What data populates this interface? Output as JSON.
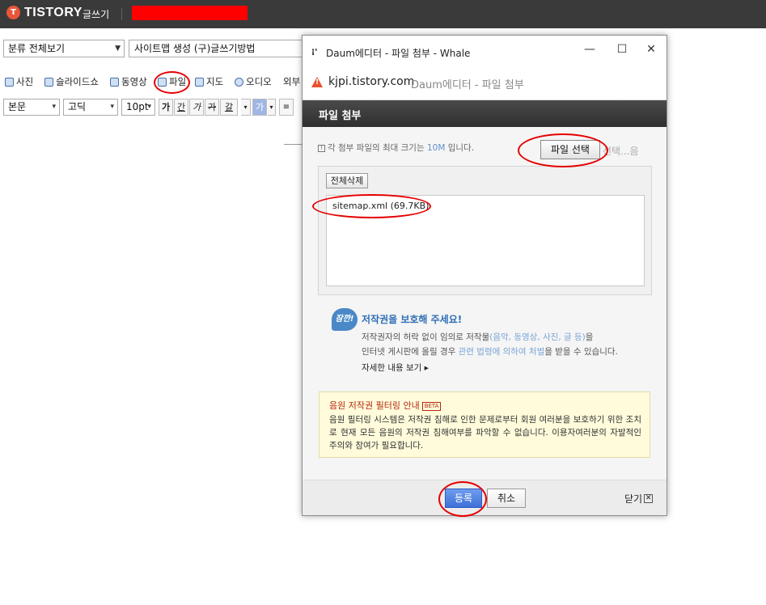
{
  "topbar": {
    "logo_glyph": "T",
    "logo_text": "TISTORY",
    "subtitle": "글쓰기",
    "redaction_color": "#ff0000"
  },
  "editor": {
    "category_select": "분류 전체보기",
    "title_value": "사이트맵 생성 (구)글쓰기방법",
    "toolbar": {
      "photo": "사진",
      "slideshow": "슬라이드쇼",
      "video": "동영상",
      "file": "파일",
      "map": "지도",
      "audio": "오디오",
      "external": "외부"
    },
    "format": {
      "paragraph": "본문",
      "font": "고딕",
      "size": "10pt",
      "bold": "가",
      "underline": "간",
      "italic": "가",
      "strike": "가",
      "font_color": "갈",
      "bg_color": "가"
    }
  },
  "popup": {
    "window_title": "Daum에디터 - 파일 첨부 - Whale",
    "controls": {
      "minimize": "—",
      "maximize": "☐",
      "close": "✕"
    },
    "address": {
      "host": "kjpi.tistory.com",
      "path": "Daum에디터 - 파일 첨부"
    },
    "header_title": "파일 첨부",
    "info": {
      "prefix": "각 첨부 파일의 최대 크기는",
      "size": "10M",
      "suffix": "입니다."
    },
    "file_select_button": "파일 선택",
    "file_select_ghost": "선택...음",
    "delete_all_button": "전체삭제",
    "files": [
      {
        "label": "sitemap.xml (69.7KB)"
      }
    ],
    "copyright": {
      "badge": "잠깐!",
      "title": "저작권을 보호해 주세요!",
      "line1_a": "저작권자의 허락 없이 임의로 저작물",
      "line1_link": "(음악, 동영상, 사진, 글 등)",
      "line1_b": "을",
      "line2_a": "인터넷 게시판에 올릴 경우",
      "line2_link": "관련 법령에 의하여 처벌",
      "line2_b": "을 받을 수 있습니다.",
      "more": "자세한 내용 보기 ▸"
    },
    "notice": {
      "title": "음원 저작권 필터링 안내",
      "beta": "BETA",
      "body": "음원 필터링 시스템은 저작권 침해로 인한 문제로부터 회원 여러분을 보호하기 위한 조치로 현재 모든 음원의 저작권 침해여부를 파악할 수 없습니다. 이용자여러분의 자발적인 주의와 참여가 필요합니다."
    },
    "footer": {
      "register": "등록",
      "cancel": "취소",
      "close": "닫기"
    }
  },
  "colors": {
    "annotation_ring": "#e60000",
    "accent_blue": "#3d6fd8",
    "header_dark": "#3a3a3a"
  }
}
